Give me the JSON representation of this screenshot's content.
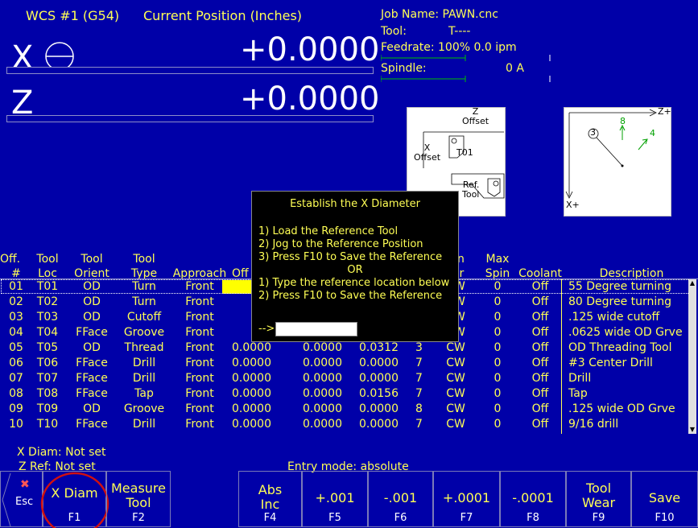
{
  "header": {
    "wcs": "WCS #1 (G54)",
    "position_title": "Current Position (Inches)",
    "x_axis": "X",
    "x_value": "+0.0000",
    "z_axis": "Z",
    "z_value": "+0.0000"
  },
  "job": {
    "name_label": "Job Name: PAWN.cnc",
    "tool_label": "Tool:",
    "tool_value": "T----",
    "feedrate": "Feedrate: 100%  0.0 ipm",
    "spindle_label": "Spindle:",
    "spindle_value": "0  A"
  },
  "diagram_left": {
    "z_offset": "Z\nOffset",
    "x_offset": "X\nOffset",
    "tool": "T01",
    "ref_tool": "Ref.\nTool",
    "paren": ")"
  },
  "diagram_right": {
    "z_plus": "Z+",
    "x_plus": "X+",
    "n3": "3",
    "n8": "8",
    "n4": "4"
  },
  "dialog": {
    "title": "Establish the X Diameter",
    "lines": [
      "1)  Load the Reference Tool",
      "2)  Jog to the Reference Position",
      "3)  Press F10 to Save the Reference",
      "OR",
      "1)  Type the reference location below",
      "2)  Press F10 to Save the Reference"
    ],
    "arrow": "-->",
    "input_value": ""
  },
  "table": {
    "headers_top": [
      "Off.",
      "Tool",
      "Tool",
      "Tool",
      "",
      "",
      "",
      "",
      "",
      "pin",
      "Max",
      "",
      ""
    ],
    "headers": [
      "#",
      "Loc",
      "Orient",
      "Type",
      "Approach",
      "Off",
      "",
      "",
      "",
      "Dir",
      "Spin",
      "Coolant",
      "Description"
    ],
    "rows": [
      [
        "01",
        "T01",
        "OD",
        "Turn",
        "Front",
        "",
        "",
        "",
        "",
        "CW",
        "0",
        "Off",
        "55 Degree turning"
      ],
      [
        "02",
        "T02",
        "OD",
        "Turn",
        "Front",
        "",
        "",
        "",
        "",
        "CW",
        "0",
        "Off",
        "80 Degree turning"
      ],
      [
        "03",
        "T03",
        "OD",
        "Cutoff",
        "Front",
        "",
        "",
        "",
        "",
        "CW",
        "0",
        "Off",
        ".125 wide cutoff"
      ],
      [
        "04",
        "T04",
        "FFace",
        "Groove",
        "Front",
        "",
        "",
        "",
        "",
        "CW",
        "0",
        "Off",
        ".0625 wide OD Grve"
      ],
      [
        "05",
        "T05",
        "OD",
        "Thread",
        "Front",
        "0.0000",
        "0.0000",
        "0.0312",
        "3",
        "CW",
        "0",
        "Off",
        "OD Threading Tool"
      ],
      [
        "06",
        "T06",
        "FFace",
        "Drill",
        "Front",
        "0.0000",
        "0.0000",
        "0.0000",
        "7",
        "CW",
        "0",
        "Off",
        "#3 Center Drill"
      ],
      [
        "07",
        "T07",
        "FFace",
        "Drill",
        "Front",
        "0.0000",
        "0.0000",
        "0.0000",
        "7",
        "CW",
        "0",
        "Off",
        "Drill"
      ],
      [
        "08",
        "T08",
        "FFace",
        "Tap",
        "Front",
        "0.0000",
        "0.0000",
        "0.0156",
        "7",
        "CW",
        "0",
        "Off",
        "Tap"
      ],
      [
        "09",
        "T09",
        "OD",
        "Groove",
        "Front",
        "0.0000",
        "0.0000",
        "0.0000",
        "8",
        "CW",
        "0",
        "Off",
        ".125 wide OD Grve"
      ],
      [
        "10",
        "T10",
        "FFace",
        "Drill",
        "Front",
        "0.0000",
        "0.0000",
        "0.0000",
        "7",
        "CW",
        "0",
        "Off",
        "9/16 drill"
      ]
    ]
  },
  "status": {
    "x_diam": "X Diam:  Not set",
    "z_ref": "Z Ref:  Not set",
    "entry_mode": "Entry mode:  absolute"
  },
  "fkeys": [
    {
      "id": "esc",
      "label": "Esc",
      "fn": ""
    },
    {
      "id": "f1",
      "label": "X Diam",
      "fn": "F1"
    },
    {
      "id": "f2",
      "label": "Measure\nTool",
      "fn": "F2"
    },
    {
      "id": "f4",
      "label": "Abs\nInc",
      "fn": "F4"
    },
    {
      "id": "f5",
      "label": "+.001",
      "fn": "F5"
    },
    {
      "id": "f6",
      "label": "-.001",
      "fn": "F6"
    },
    {
      "id": "f7",
      "label": "+.0001",
      "fn": "F7"
    },
    {
      "id": "f8",
      "label": "-.0001",
      "fn": "F8"
    },
    {
      "id": "f9",
      "label": "Tool\nWear",
      "fn": "F9"
    },
    {
      "id": "f10",
      "label": "Save",
      "fn": "F10"
    }
  ],
  "colors": {
    "background": "#0000a8",
    "text": "#ffff55",
    "highlight_circle": "#d01010"
  }
}
